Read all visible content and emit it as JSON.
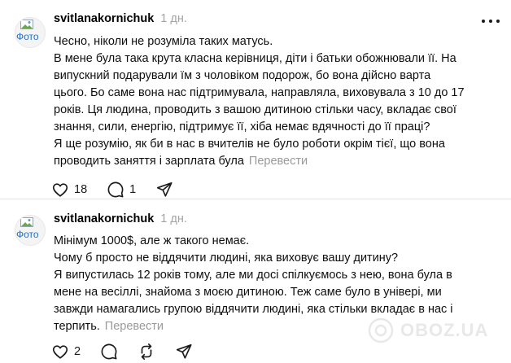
{
  "posts": [
    {
      "username": "svitlanakornichuk",
      "time": "1 дн.",
      "avatar_alt": "Фото",
      "lines": [
        "Чесно, ніколи не розуміла таких матусь.",
        "В мене була така крута класна керівниця, діти і батьки обожнювали її. На",
        "випускний подарували їм з чоловіком подорож, бо вона дійсно варта",
        "цього. Бо саме вона нас підтримувала, направляла, виховувала з 10 до 17",
        "років. Ця людина, проводить з вашою дитиною стільки часу, вкладає свої",
        "знання, сили, енергію, підтримує її, хіба немає вдячності до її праці?",
        "Я ще розумію, як би в нас в вчителів не було роботи окрім тієї, що вона",
        "проводить заняття і зарплата була"
      ],
      "translate_label": "Перевести",
      "likes": "18",
      "replies": "1",
      "reposts": "",
      "icons": [
        "heart-icon",
        "comment-icon",
        "share-icon"
      ]
    },
    {
      "username": "svitlanakornichuk",
      "time": "1 дн.",
      "avatar_alt": "Фото",
      "lines": [
        "Мінімум 1000$, але ж такого немає.",
        "Чому б просто не віддячити людині, яка виховує вашу дитину?",
        "Я випустилась 12 років тому, але ми досі спілкуємось з нею, вона була в",
        "мене на весіллі, знайома з моєю дитиною. Теж саме було в універі, ми",
        "завжди намагались групою віддячити людині, яка стільки вкладає в нас і",
        "терпить."
      ],
      "translate_label": "Перевести",
      "likes": "2",
      "replies": "",
      "reposts": "",
      "icons": [
        "heart-icon",
        "comment-icon",
        "repost-icon",
        "share-icon"
      ]
    }
  ],
  "watermark": {
    "text": "OBOZ.UA",
    "icon": "oboz-logo-icon"
  }
}
